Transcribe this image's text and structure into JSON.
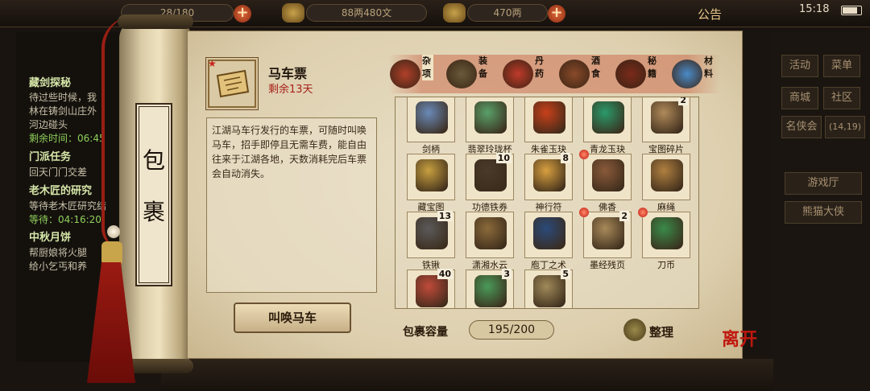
{
  "topbar": {
    "stamina": "28/180",
    "money": "88两480文",
    "gold": "470两",
    "notice": "公告",
    "clock": "15:18"
  },
  "quests": [
    {
      "title": "藏剑探秘",
      "lines": [
        "待过些时候，我",
        "林在铸剑山庄外",
        "河边碰头"
      ],
      "timer": "剩余时间：06:45"
    },
    {
      "title": "门派任务",
      "lines": [
        "回天门门交差"
      ]
    },
    {
      "title": "老木匠的研究",
      "lines": [
        "等待老木匠研究结"
      ],
      "timer": "等待：04:16:20"
    },
    {
      "title": "中秋月饼",
      "lines": [
        "帮厨娘将火腿",
        "给小乞丐和养"
      ]
    }
  ],
  "rightmenu": {
    "activity": "活动",
    "menu": "菜单",
    "shop": "商城",
    "community": "社区",
    "rank": "名侠会",
    "rank_coords": "(14,19)",
    "game_hall": "游戏厅",
    "panda": "熊猫大侠"
  },
  "scroll": {
    "title_chars": [
      "包",
      "裹"
    ]
  },
  "detail": {
    "name": "马车票",
    "remain": "剩余13天",
    "description": "江湖马车行发行的车票，可随时叫唤马车，招手即停且无需车费，能自由往来于江湖各地，天数消耗完后车票会自动消失。",
    "action": "叫唤马车",
    "icon": "carriage-ticket-icon"
  },
  "tabs": [
    {
      "label": "杂项",
      "icon": "pot-icon",
      "color": "#b0402a",
      "active": true
    },
    {
      "label": "装备",
      "icon": "gear-bundle-icon",
      "color": "#6a5a3a",
      "active": false
    },
    {
      "label": "丹药",
      "icon": "pill-icon",
      "color": "#c03a2a",
      "active": false
    },
    {
      "label": "酒食",
      "icon": "wine-jar-icon",
      "color": "#8a4a2a",
      "active": false
    },
    {
      "label": "秘籍",
      "icon": "book-icon",
      "color": "#7a2a1a",
      "active": false
    },
    {
      "label": "材料",
      "icon": "crystal-icon",
      "color": "#4a8ac8",
      "active": false
    }
  ],
  "items": [
    {
      "name": "剑柄",
      "count": "",
      "dot": false,
      "color": "#6a8ab8",
      "icon": "sword-hilt-icon"
    },
    {
      "name": "翡翠玲珑杯",
      "count": "",
      "dot": false,
      "color": "#5aa06a",
      "icon": "jade-cup-icon"
    },
    {
      "name": "朱雀玉玦",
      "count": "",
      "dot": false,
      "color": "#c8401a",
      "icon": "phoenix-jade-icon"
    },
    {
      "name": "青龙玉玦",
      "count": "",
      "dot": false,
      "color": "#2a9a6a",
      "icon": "dragon-jade-icon"
    },
    {
      "name": "宝图碎片",
      "count": "2",
      "dot": false,
      "color": "#b08a5a",
      "icon": "map-fragment-icon"
    },
    {
      "name": "藏宝图",
      "count": "",
      "dot": false,
      "color": "#c8a040",
      "icon": "treasure-map-icon"
    },
    {
      "name": "功德铁券",
      "count": "10",
      "dot": false,
      "color": "#4a3a2a",
      "icon": "iron-certificate-icon"
    },
    {
      "name": "神行符",
      "count": "8",
      "dot": false,
      "color": "#d8a040",
      "icon": "talisman-icon"
    },
    {
      "name": "佛香",
      "count": "",
      "dot": true,
      "color": "#8a5a3a",
      "icon": "incense-icon"
    },
    {
      "name": "麻绳",
      "count": "",
      "dot": false,
      "color": "#b08040",
      "icon": "rope-icon"
    },
    {
      "name": "铁锹",
      "count": "13",
      "dot": false,
      "color": "#5a5a5a",
      "icon": "shovel-icon"
    },
    {
      "name": "潇湘水云",
      "count": "",
      "dot": false,
      "color": "#8a6a3a",
      "icon": "scroll-book-icon"
    },
    {
      "name": "庖丁之术",
      "count": "",
      "dot": false,
      "color": "#2a4a7a",
      "icon": "cook-book-icon"
    },
    {
      "name": "墨经残页",
      "count": "2",
      "dot": true,
      "color": "#a88a5a",
      "icon": "torn-page-icon"
    },
    {
      "name": "刀币",
      "count": "",
      "dot": true,
      "color": "#3a8a4a",
      "icon": "knife-coin-icon"
    },
    {
      "name": "",
      "count": "40",
      "dot": false,
      "color": "#c04a3a",
      "icon": "worm-icon"
    },
    {
      "name": "",
      "count": "3",
      "dot": false,
      "color": "#4a9a5a",
      "icon": "fishing-rod-icon"
    },
    {
      "name": "",
      "count": "5",
      "dot": false,
      "color": "#a08a5a",
      "icon": "scroll-bundle-icon"
    }
  ],
  "capacity": {
    "label": "包裹容量",
    "value": "195/200"
  },
  "sort": {
    "label": "整理"
  },
  "close": {
    "label": "离开"
  }
}
